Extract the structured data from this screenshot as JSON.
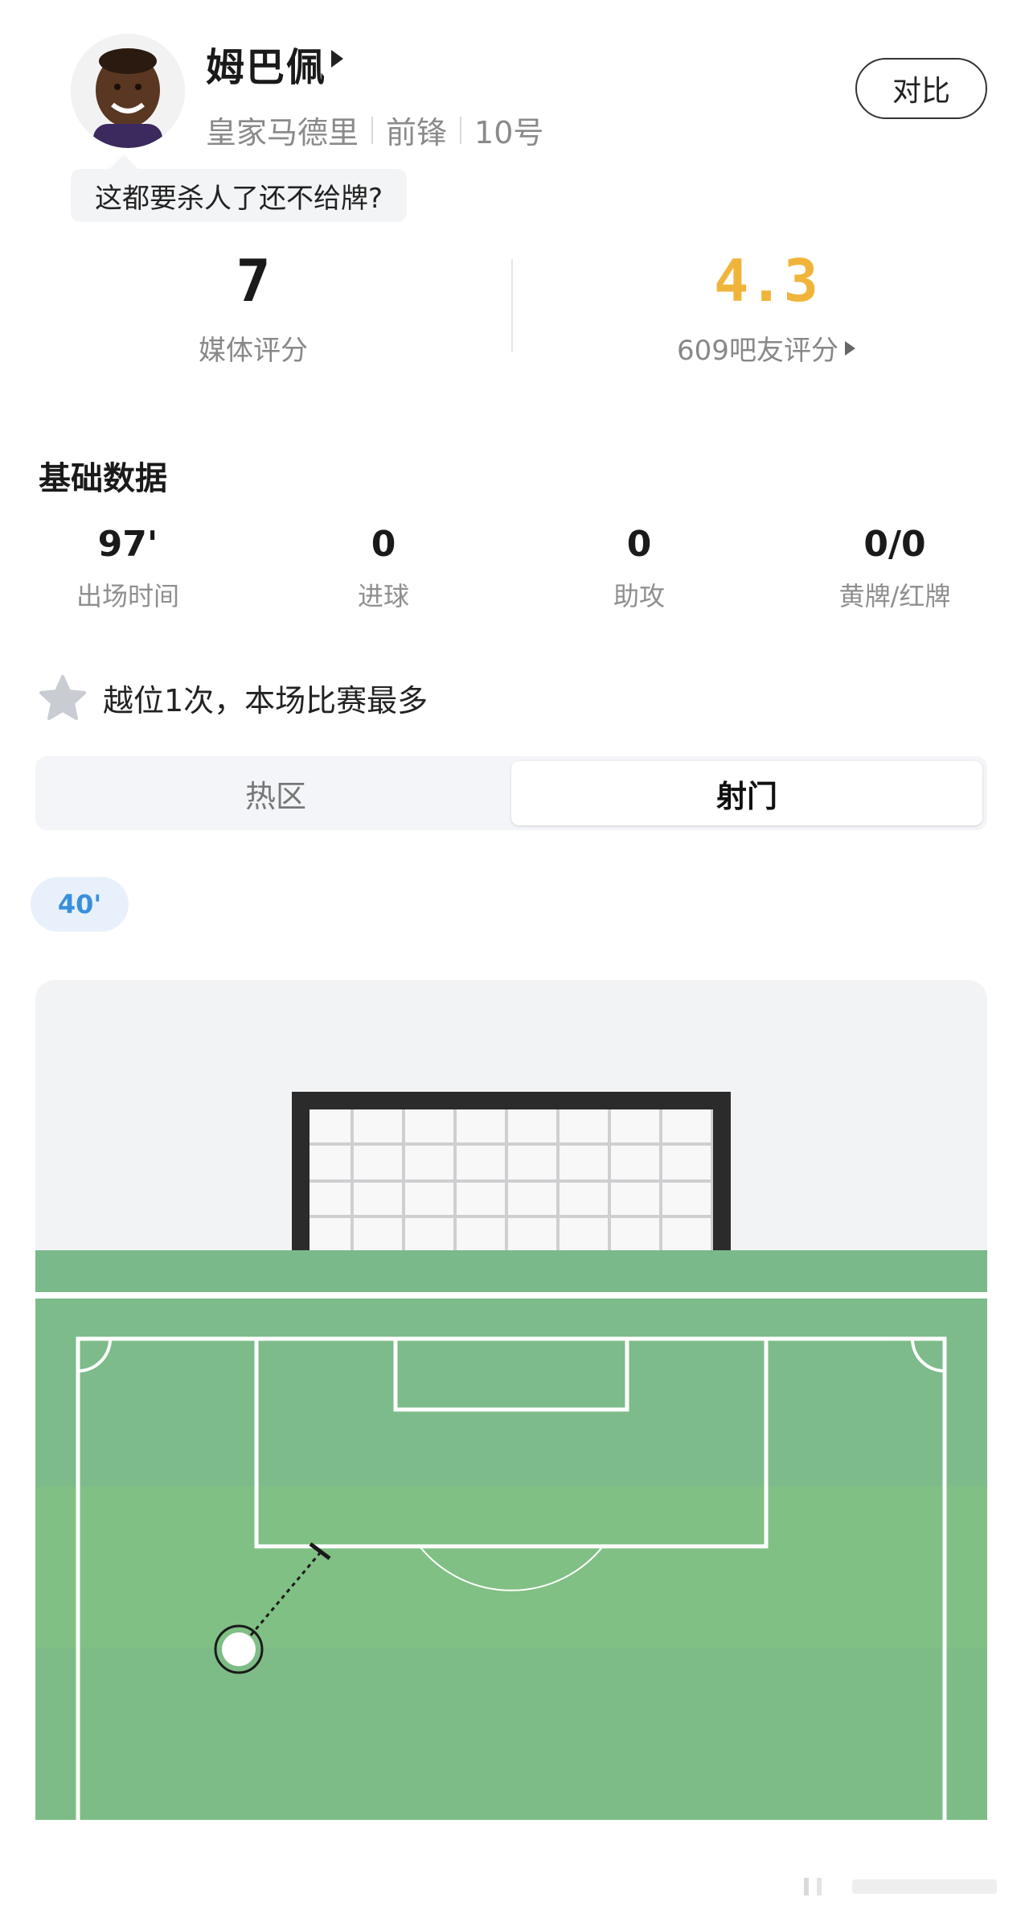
{
  "header": {
    "player_name": "姆巴佩",
    "team": "皇家马德里",
    "position": "前锋",
    "number": "10号",
    "compare_label": "对比",
    "comment": "这都要杀人了还不给牌?"
  },
  "ratings": {
    "media_value": "7",
    "media_label": "媒体评分",
    "fan_value": "4.3",
    "fan_label": "609吧友评分",
    "fan_color": "#f1b43b"
  },
  "basic_stats": {
    "title": "基础数据",
    "items": [
      {
        "value": "97'",
        "label": "出场时间"
      },
      {
        "value": "0",
        "label": "进球"
      },
      {
        "value": "0",
        "label": "助攻"
      },
      {
        "value": "0/0",
        "label": "黄牌/红牌"
      }
    ]
  },
  "highlight": {
    "icon": "star-icon",
    "text": "越位1次，本场比赛最多"
  },
  "tabs": {
    "items": [
      {
        "label": "热区",
        "active": false
      },
      {
        "label": "射门",
        "active": true
      }
    ]
  },
  "shot_filter": {
    "minute_chip": "40'",
    "chip_color": "#3a8fdc"
  },
  "colors": {
    "pitch_green": "#7dbb84",
    "pitch_light": "#86c480",
    "goal_frame": "#2b2b2b"
  }
}
